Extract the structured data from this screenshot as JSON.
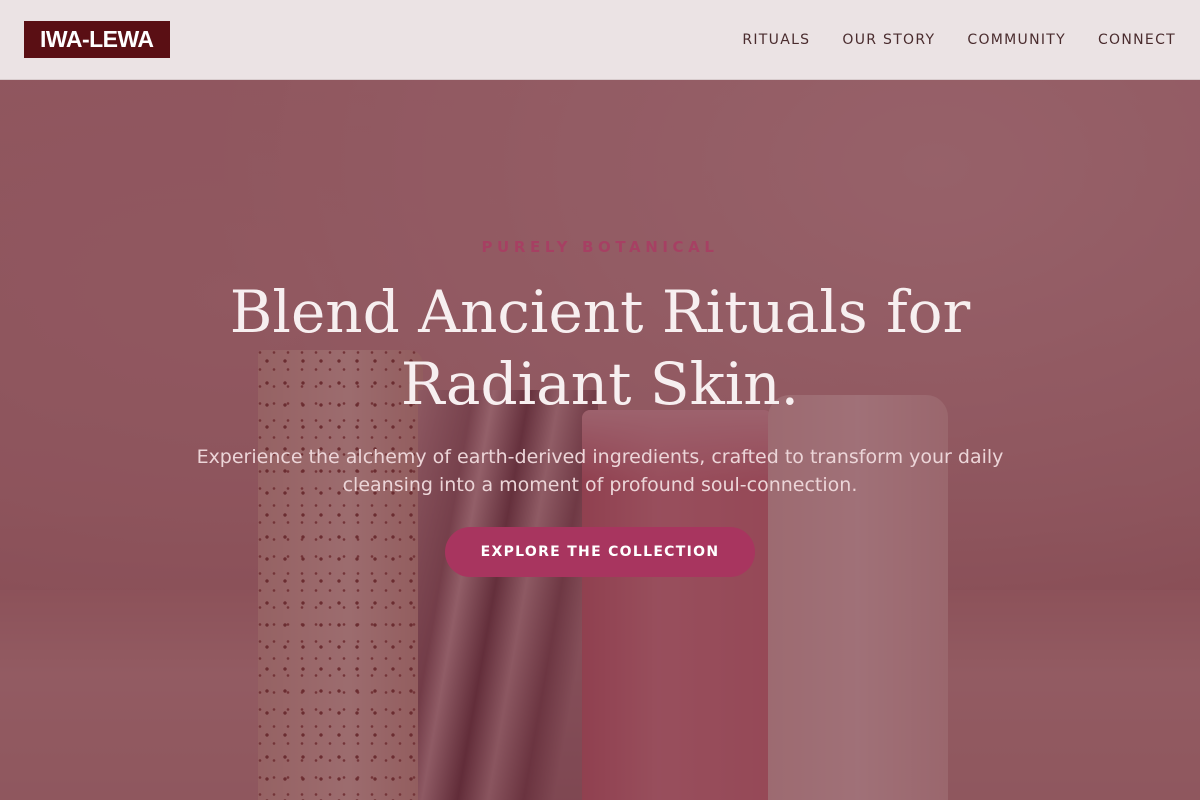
{
  "header": {
    "logo": "IWA-LEWA",
    "nav": [
      {
        "label": "RITUALS"
      },
      {
        "label": "OUR STORY"
      },
      {
        "label": "COMMUNITY"
      },
      {
        "label": "CONNECT"
      }
    ]
  },
  "hero": {
    "eyebrow": "PURELY BOTANICAL",
    "headline": "Blend Ancient Rituals for Radiant Skin.",
    "subtext": "Experience the alchemy of earth-derived ingredients, crafted to transform your daily cleansing into a moment of profound soul-connection.",
    "cta_label": "EXPLORE THE COLLECTION",
    "background_image": "handmade-soap-bars"
  },
  "colors": {
    "brand_maroon": "#5a0f14",
    "accent_pink": "#a8355f",
    "header_bg": "#ebe3e4",
    "overlay": "#601828"
  }
}
